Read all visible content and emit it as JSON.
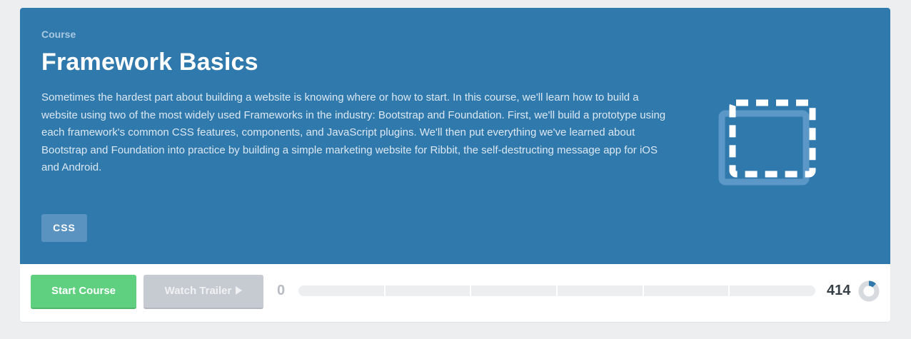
{
  "course": {
    "eyebrow": "Course",
    "title": "Framework Basics",
    "description": "Sometimes the hardest part about building a website is knowing where or how to start. In this course, we'll learn how to build a website using two of the most widely used Frameworks in the industry: Bootstrap and Foundation. First, we'll build a prototype using each framework's common CSS features, components, and JavaScript plugins. We'll then put everything we've learned about Bootstrap and Foundation into practice by building a simple marketing website for Ribbit, the self-destructing message app for iOS and Android.",
    "icon": "dashed-square-icon",
    "tag": "CSS"
  },
  "actions": {
    "start_label": "Start Course",
    "trailer_label": "Watch Trailer",
    "trailer_icon": "play-icon"
  },
  "progress": {
    "earned": "0",
    "total": "414",
    "fraction": 0,
    "segments": 6,
    "ring_fraction": 0.12
  },
  "colors": {
    "hero_background": "#3079ad",
    "start_button": "#5fcf80",
    "trailer_button": "#c6cbd2",
    "tag_background": "#5a93c0",
    "progress_track": "#edeef0",
    "progress_accent": "#3079ad"
  }
}
